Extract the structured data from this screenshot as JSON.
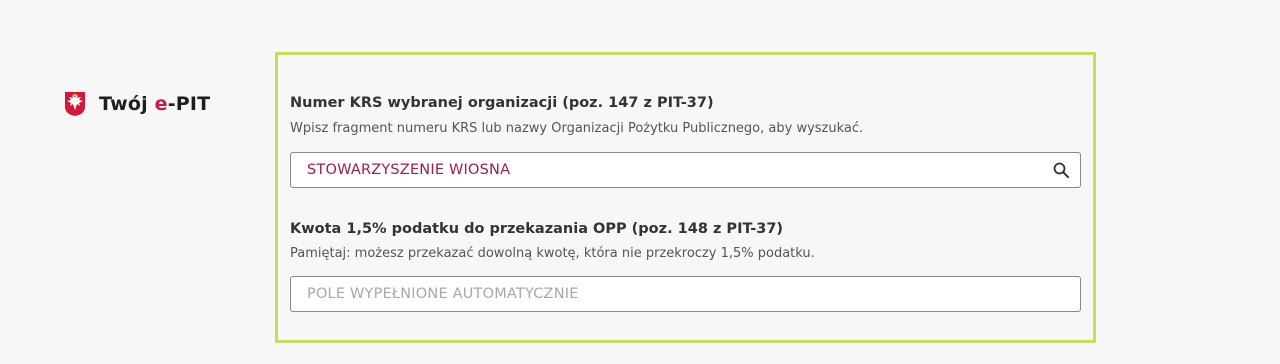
{
  "brand": {
    "prefix": "Twój ",
    "accent": "e",
    "suffix": "-PIT",
    "accent_color": "#c8174a",
    "emblem_icon": "polish-eagle-emblem-icon"
  },
  "krs_field": {
    "title": "Numer KRS wybranej organizacji (poz. 147 z PIT-37)",
    "hint": "Wpisz fragment numeru KRS lub nazwy Organizacji Pożytku Publicznego, aby wyszukać.",
    "value": "STOWARZYSZENIE WIOSNA",
    "icon": "search-icon"
  },
  "amount_field": {
    "title": "Kwota 1,5% podatku do przekazania OPP (poz. 148 z PIT-37)",
    "hint": "Pamiętaj: możesz przekazać dowolną kwotę, która nie przekroczy 1,5% podatku.",
    "placeholder": "POLE WYPEŁNIONE AUTOMATYCZNIE"
  },
  "colors": {
    "panel_border": "#c8dc5a",
    "value_text": "#9c1d4f"
  }
}
